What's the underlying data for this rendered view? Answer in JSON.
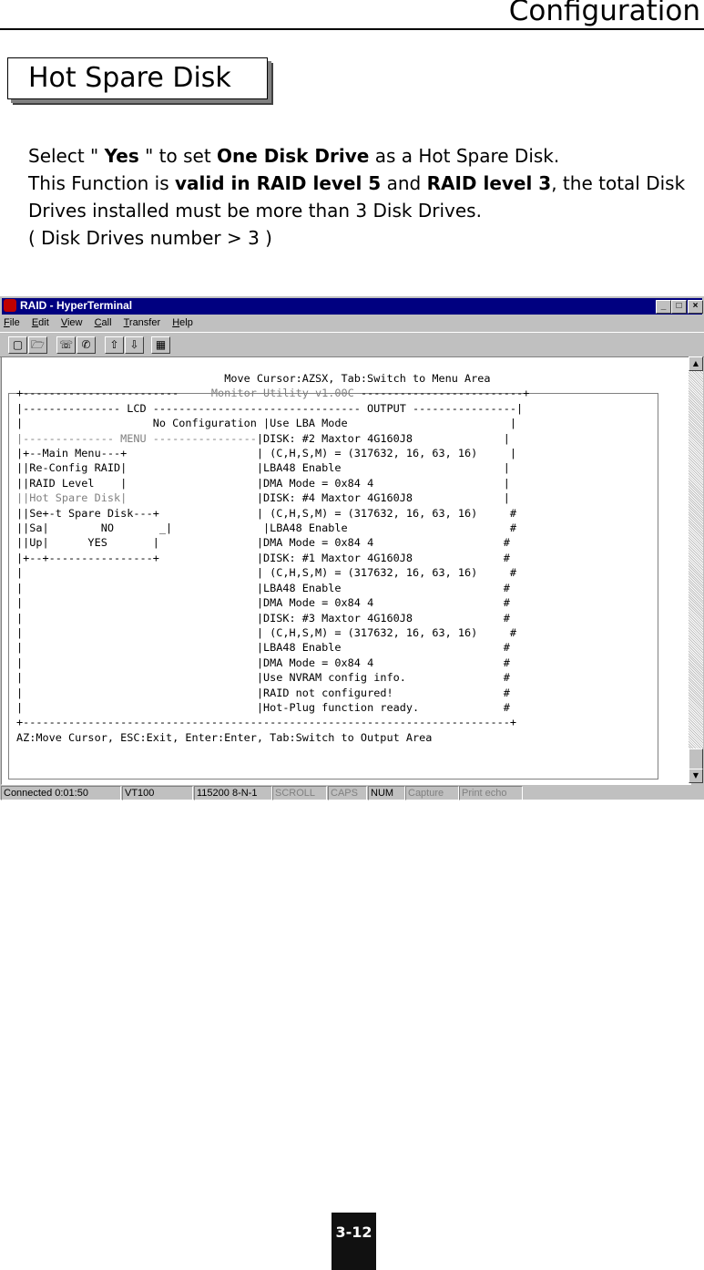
{
  "page": {
    "title": "Configuration",
    "section_title": "Hot Spare Disk",
    "page_number": "3-12"
  },
  "description": {
    "line1": {
      "a": "Select \" ",
      "b": "Yes",
      "c": " \" to set ",
      "d": "One Disk Drive",
      "e": " as a Hot Spare Disk."
    },
    "line2": {
      "a": "This Function is ",
      "b": "valid in RAID level 5",
      "c": " and ",
      "d": "RAID level 3",
      "e": ", the total Disk"
    },
    "line3": "Drives installed must be more than 3 Disk Drives.",
    "line4": "( Disk Drives number > 3 )"
  },
  "window": {
    "title": "RAID - HyperTerminal",
    "controls": [
      "_",
      "□",
      "×"
    ],
    "menu": [
      "File",
      "Edit",
      "View",
      "Call",
      "Transfer",
      "Help"
    ],
    "icons": [
      "new-icon",
      "open-icon",
      "phone-icon",
      "disconnect-icon",
      "send-icon",
      "receive-icon",
      "properties-icon"
    ]
  },
  "terminal": {
    "header_hint": "Move Cursor:AZSX, Tab:Switch to Menu Area",
    "top_border_left": "+------------------------",
    "utility_title": "Monitor Utility v1.00C",
    "top_border_right": "-------------------------+",
    "lcd_output_header": "|--------------- LCD -------------------------------- OUTPUT ----------------|",
    "rows": [
      {
        "left": "|                    No Configuration ",
        "right": "|Use LBA Mode                         |"
      },
      {
        "left": "|-------------- MENU ----------------",
        "right": "|DISK: #2 Maxtor 4G160J8              |",
        "gray": true
      },
      {
        "left": "|+--Main Menu---+                    ",
        "right": "| (C,H,S,M) = (317632, 16, 63, 16)     |"
      },
      {
        "left": "||Re-Config RAID|                    ",
        "right": "|LBA48 Enable                         |"
      },
      {
        "left": "||RAID Level    |                    ",
        "right": "|DMA Mode = 0x84 4                    |"
      },
      {
        "left": "||Hot Spare Disk|                    ",
        "right": "|DISK: #4 Maxtor 4G160J8              |"
      },
      {
        "left": "||Se+-t Spare Disk---+               ",
        "right": "| (C,H,S,M) = (317632, 16, 63, 16)     #"
      },
      {
        "left": "||Sa|        NO       _|              ",
        "right": "|LBA48 Enable                         #"
      },
      {
        "left": "||Up|      YES       |               ",
        "right": "|DMA Mode = 0x84 4                    #"
      },
      {
        "left": "|+--+----------------+               ",
        "right": "|DISK: #1 Maxtor 4G160J8              #"
      },
      {
        "left": "|                                    ",
        "right": "| (C,H,S,M) = (317632, 16, 63, 16)     #"
      },
      {
        "left": "|                                    ",
        "right": "|LBA48 Enable                         #"
      },
      {
        "left": "|                                    ",
        "right": "|DMA Mode = 0x84 4                    #"
      },
      {
        "left": "|                                    ",
        "right": "|DISK: #3 Maxtor 4G160J8              #"
      },
      {
        "left": "|                                    ",
        "right": "| (C,H,S,M) = (317632, 16, 63, 16)     #"
      },
      {
        "left": "|                                    ",
        "right": "|LBA48 Enable                         #"
      },
      {
        "left": "|                                    ",
        "right": "|DMA Mode = 0x84 4                    #"
      },
      {
        "left": "|                                    ",
        "right": "|Use NVRAM config info.               #"
      },
      {
        "left": "|                                    ",
        "right": "|RAID not configured!                 #"
      },
      {
        "left": "|                                    ",
        "right": "|Hot-Plug function ready.             #"
      }
    ],
    "bottom_border": "+---------------------------------------------------------------------------+",
    "footer_hint": "AZ:Move Cursor, ESC:Exit, Enter:Enter, Tab:Switch to Output Area"
  },
  "statusbar": {
    "connected": "Connected 0:01:50",
    "emulation": "VT100",
    "settings": "115200 8-N-1",
    "scroll": "SCROLL",
    "caps": "CAPS",
    "num": "NUM",
    "capture": "Capture",
    "print_echo": "Print echo"
  }
}
